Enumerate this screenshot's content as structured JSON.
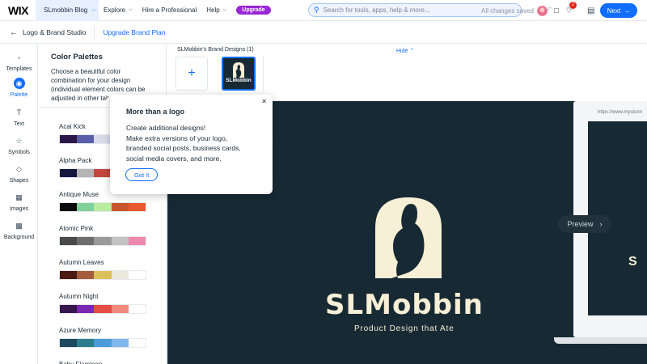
{
  "topbar": {
    "logo": "WIX",
    "site_name": "SLmobbin Blog",
    "nav": [
      "Explore",
      "Hire a Professional",
      "Help"
    ],
    "upgrade_label": "Upgrade",
    "search_placeholder": "Search for tools, apps, help & more...",
    "notification_count": "2"
  },
  "subbar": {
    "title": "Logo & Brand Studio",
    "upgrade_link": "Upgrade Brand Plan",
    "status": "All changes saved",
    "next_label": "Next"
  },
  "rail": {
    "items": [
      {
        "label": "Templates",
        "icon": "templates-icon"
      },
      {
        "label": "Palette",
        "icon": "palette-icon"
      },
      {
        "label": "Text",
        "icon": "text-icon"
      },
      {
        "label": "Symbols",
        "icon": "symbols-icon"
      },
      {
        "label": "Shapes",
        "icon": "shapes-icon"
      },
      {
        "label": "Images",
        "icon": "images-icon"
      },
      {
        "label": "Background",
        "icon": "background-icon"
      }
    ]
  },
  "panel": {
    "title": "Color Palettes",
    "description": "Choose a beautiful color combination for your design (individual element colors can be adjusted in other tabs)",
    "palettes": [
      {
        "name": "Acai Kick",
        "colors": [
          "#2b1848",
          "#5a5ea8",
          "#d8dbe8",
          "#ffffff",
          "#ffffff"
        ]
      },
      {
        "name": "Alpha Pack",
        "colors": [
          "#15183d",
          "#b4b4b4",
          "#c4463e",
          "#ffffff",
          "#ffffff"
        ]
      },
      {
        "name": "Antique Muse",
        "colors": [
          "#0a0a0a",
          "#7fd39a",
          "#b8ec9e",
          "#c7572b",
          "#e75a2d"
        ]
      },
      {
        "name": "Atomic Pink",
        "colors": [
          "#4a4a4a",
          "#6e6e6e",
          "#9a9a9a",
          "#c3c3c3",
          "#ef88ad"
        ]
      },
      {
        "name": "Autumn Leaves",
        "colors": [
          "#4a1a13",
          "#a55c3d",
          "#dcc05a",
          "#ece7dc",
          "#ffffff"
        ]
      },
      {
        "name": "Autumn Night",
        "colors": [
          "#36164d",
          "#7b27b3",
          "#e24c42",
          "#ef8a7d",
          "#ffffff"
        ]
      },
      {
        "name": "Azure Memory",
        "colors": [
          "#1d4a5f",
          "#2c7d8e",
          "#4a9dd9",
          "#7fb8ee",
          "#ffffff"
        ]
      },
      {
        "name": "Baby Flamingo",
        "colors": [
          "#e8a0b0",
          "#f2c0c8",
          "#f8dde2",
          "#ffffff",
          "#ffffff"
        ]
      }
    ]
  },
  "strip": {
    "title": "SLMobbin's Brand Designs (1)",
    "hide_label": "Hide",
    "tile_text": "SLMobbin"
  },
  "canvas": {
    "brand_name": "SLMobbin",
    "tagline": "Product Design that Ate",
    "device_url": "https://www.mystunn",
    "device_text": "S",
    "preview_label": "Preview",
    "colors": {
      "background": "#172a34",
      "logo": "#f7efd6"
    }
  },
  "popover": {
    "title": "More than a logo",
    "lines": [
      "Create additional designs!",
      "Make extra versions of your logo,",
      "branded social posts, business cards,",
      "social media covers, and more."
    ],
    "button_label": "Got It"
  }
}
